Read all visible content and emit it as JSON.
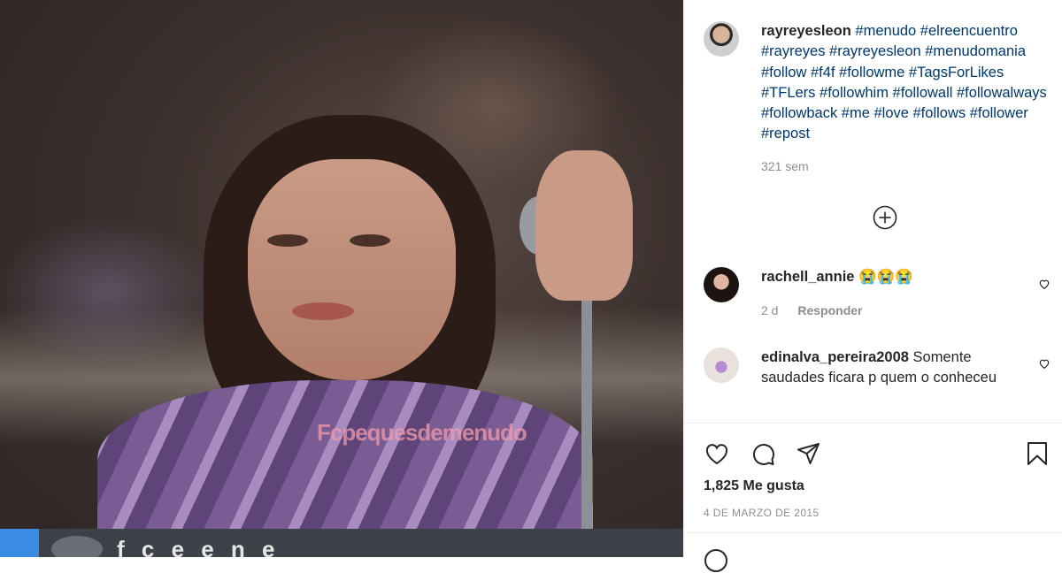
{
  "photo": {
    "watermark": "Fcpequesdemenudo",
    "strip_text": "f   c   e   e   n   e"
  },
  "post": {
    "username": "rayreyesleon",
    "hashtags": "#menudo #elreencuentro #rayreyes #rayreyesleon #menudomania #follow #f4f #followme #TagsForLikes #TFLers #followhim #followall #followalways #followback #me #love #follows #follower #repost",
    "age": "321 sem"
  },
  "comments": [
    {
      "username": "rachell_annie",
      "text": "😭😭😭",
      "time": "2 d",
      "reply": "Responder"
    },
    {
      "username": "edinalva_pereira2008",
      "text": "Somente saudades ficara p quem o conheceu"
    }
  ],
  "actions": {
    "likes": "1,825 Me gusta",
    "date": "4 DE MARZO DE 2015"
  },
  "icons": {
    "like": "heart-icon",
    "comment": "comment-icon",
    "share": "share-icon",
    "save": "bookmark-icon",
    "load_more": "plus-circle-icon"
  }
}
